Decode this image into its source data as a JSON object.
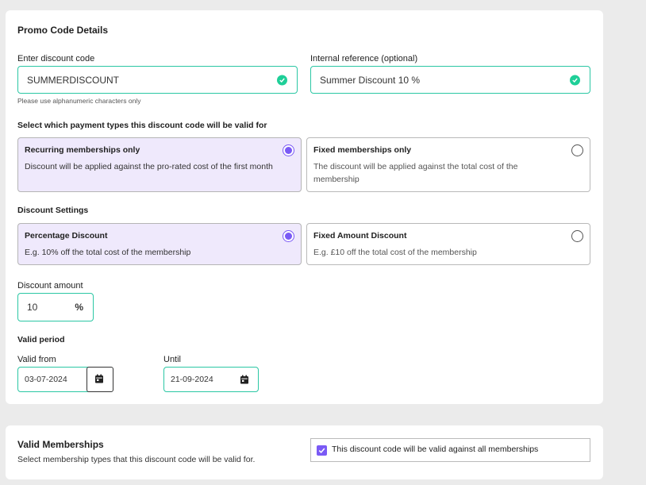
{
  "promo": {
    "title": "Promo Code Details",
    "code_label": "Enter discount code",
    "code_value": "SUMMERDISCOUNT",
    "code_hint": "Please use alphanumeric characters only",
    "ref_label": "Internal reference (optional)",
    "ref_value": "Summer Discount 10 %"
  },
  "payment_types": {
    "heading": "Select which payment types this discount code will be valid for",
    "options": [
      {
        "title": "Recurring memberships only",
        "desc": "Discount will be applied against the pro-rated cost of the first month",
        "selected": true
      },
      {
        "title": "Fixed memberships only",
        "desc": "The discount will be applied against the total cost of the membership",
        "selected": false
      }
    ]
  },
  "discount_settings": {
    "heading": "Discount Settings",
    "options": [
      {
        "title": "Percentage Discount",
        "desc": "E.g. 10% off the total cost of the membership",
        "selected": true
      },
      {
        "title": "Fixed Amount Discount",
        "desc": "E.g. £10 off the total cost of the membership",
        "selected": false
      }
    ],
    "amount_label": "Discount amount",
    "amount_value": "10",
    "amount_unit": "%"
  },
  "valid_period": {
    "heading": "Valid period",
    "from_label": "Valid from",
    "from_value": "03-07-2024",
    "until_label": "Until",
    "until_value": "21-09-2024"
  },
  "memberships": {
    "title": "Valid Memberships",
    "subtitle": "Select membership types that this discount code will be valid for.",
    "all_label": "This discount code will be valid against all memberships",
    "all_checked": true
  },
  "colors": {
    "accent": "#7a5af5",
    "valid": "#2bc7a4",
    "selected_bg": "#efe9fc"
  }
}
